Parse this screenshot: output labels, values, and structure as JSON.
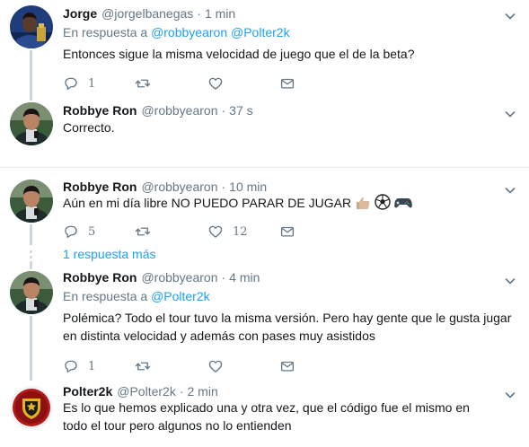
{
  "tweets": [
    {
      "name": "Jorge",
      "handle": "@jorgelbanegas",
      "time": "1 min",
      "reply_prefix": "En respuesta a",
      "reply_to": [
        "@robbyearon",
        "@Polter2k"
      ],
      "text": "Entonces sigue la misma velocidad de juego que el de la beta?",
      "replies": "1",
      "retweets": "",
      "likes": ""
    },
    {
      "name": "Robbye Ron",
      "handle": "@robbyearon",
      "time": "37 s",
      "text": "Correcto."
    },
    {
      "name": "Robbye Ron",
      "handle": "@robbyearon",
      "time": "10 min",
      "text": "Aún en mi día libre NO PUEDO PARAR DE JUGAR",
      "replies": "5",
      "retweets": "",
      "likes": "12"
    },
    {
      "more_replies": "1 respuesta más"
    },
    {
      "name": "Robbye Ron",
      "handle": "@robbyearon",
      "time": "4 min",
      "reply_prefix": "En respuesta a",
      "reply_to": [
        "@Polter2k"
      ],
      "text_line1": "Polémica? Todo el tour tuvo la misma versión. Pero hay gente que le gusta jugar",
      "text_line2": "en distinta velocidad y además con pases muy asistidos",
      "replies": "1",
      "retweets": "",
      "likes": ""
    },
    {
      "name": "Polter2k",
      "handle": "@Polter2k",
      "time": "2 min",
      "text_line1": "Es lo que hemos explicado una y otra vez, que el código fue el mismo en",
      "text_line2": "todo el tour pero algunos no lo entienden"
    }
  ],
  "separator": "·",
  "colors": {
    "accent": "#1da1f2",
    "muted": "#657786",
    "text": "#14171a",
    "line": "#ccd6dd",
    "divider": "#e6ecf0"
  },
  "icons": [
    "reply-icon",
    "retweet-icon",
    "like-icon",
    "direct-message-icon",
    "chevron-down-icon",
    "thumbs-up-icon",
    "soccer-ball-icon",
    "gamepad-icon"
  ]
}
